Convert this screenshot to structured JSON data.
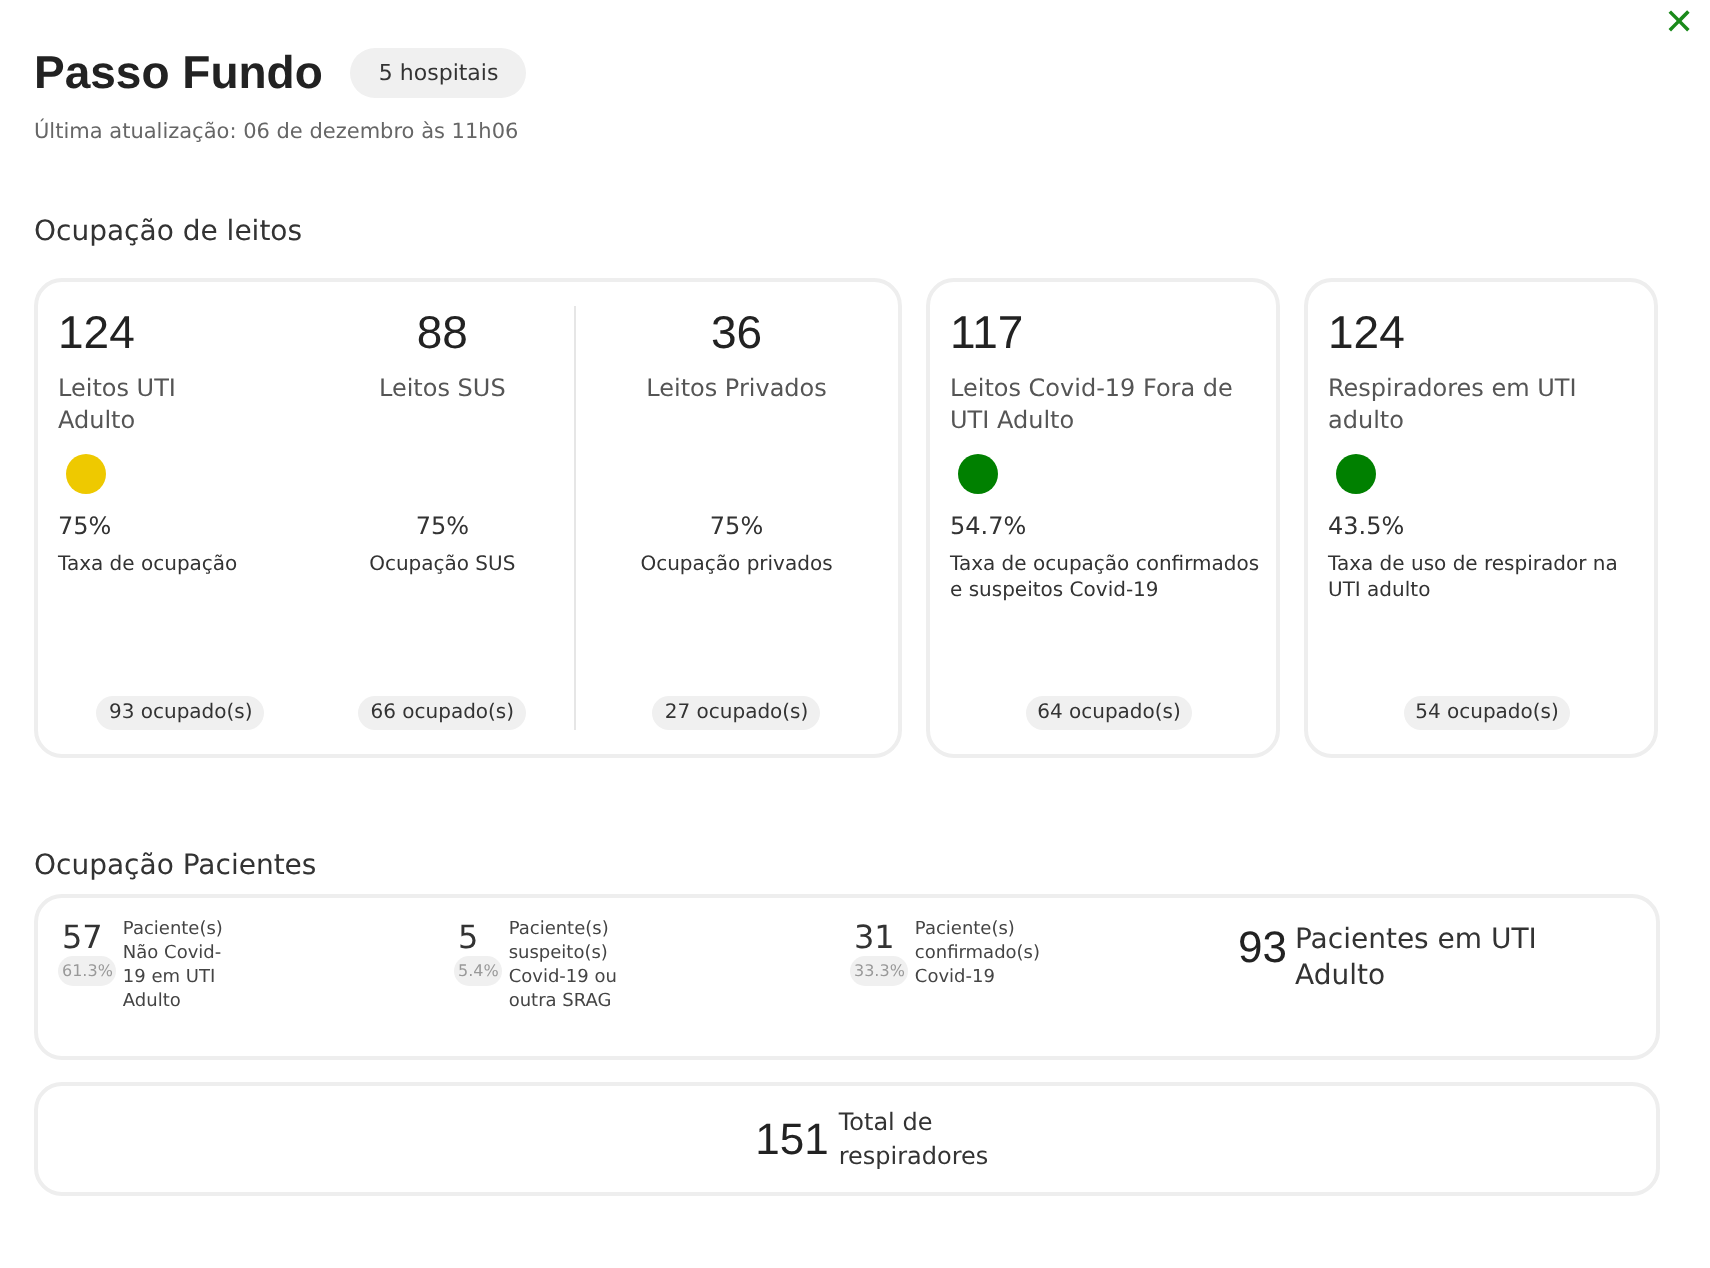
{
  "header": {
    "title": "Passo Fundo",
    "badge": "5 hospitais",
    "updated": "Última atualização: 06 de dezembro às 11h06",
    "close": "✕"
  },
  "beds": {
    "title": "Ocupação de leitos",
    "cards": [
      {
        "columns": [
          {
            "value": "124",
            "label": "Leitos UTI Adulto",
            "color": "#eec900",
            "percent": "75%",
            "rate_label": "Taxa de ocupação",
            "occupied": "93 ocupado(s)"
          },
          {
            "value": "88",
            "label": "Leitos SUS",
            "percent": "75%",
            "rate_label": "Ocupação SUS",
            "occupied": "66 ocupado(s)"
          },
          {
            "value": "36",
            "label": "Leitos Privados",
            "percent": "75%",
            "rate_label": "Ocupação privados",
            "occupied": "27 ocupado(s)"
          }
        ]
      },
      {
        "columns": [
          {
            "value": "117",
            "label": "Leitos Covid-19 Fora de UTI Adulto",
            "color": "#008000",
            "percent": "54.7%",
            "rate_label": "Taxa de ocupação confirmados e suspeitos Covid-19",
            "occupied": "64 ocupado(s)"
          }
        ]
      },
      {
        "columns": [
          {
            "value": "124",
            "label": "Respiradores em UTI adulto",
            "color": "#008000",
            "percent": "43.5%",
            "rate_label": "Taxa de uso de respirador na UTI adulto",
            "occupied": "54 ocupado(s)"
          }
        ]
      }
    ]
  },
  "patients": {
    "title": "Ocupação Pacientes",
    "items": [
      {
        "kind": "group",
        "value": "57",
        "percent": "61.3%",
        "label": "Paciente(s) Não Covid-19 em UTI Adulto"
      },
      {
        "kind": "group",
        "value": "5",
        "percent": "5.4%",
        "label": "Paciente(s) suspeito(s) Covid-19 ou outra SRAG"
      },
      {
        "kind": "group",
        "value": "31",
        "percent": "33.3%",
        "label": "Paciente(s) confirmado(s) Covid-19"
      },
      {
        "kind": "total",
        "value": "93",
        "label": "Pacientes em UTI Adulto"
      }
    ],
    "respirators": {
      "value": "151",
      "label": "Total de respiradores"
    }
  }
}
